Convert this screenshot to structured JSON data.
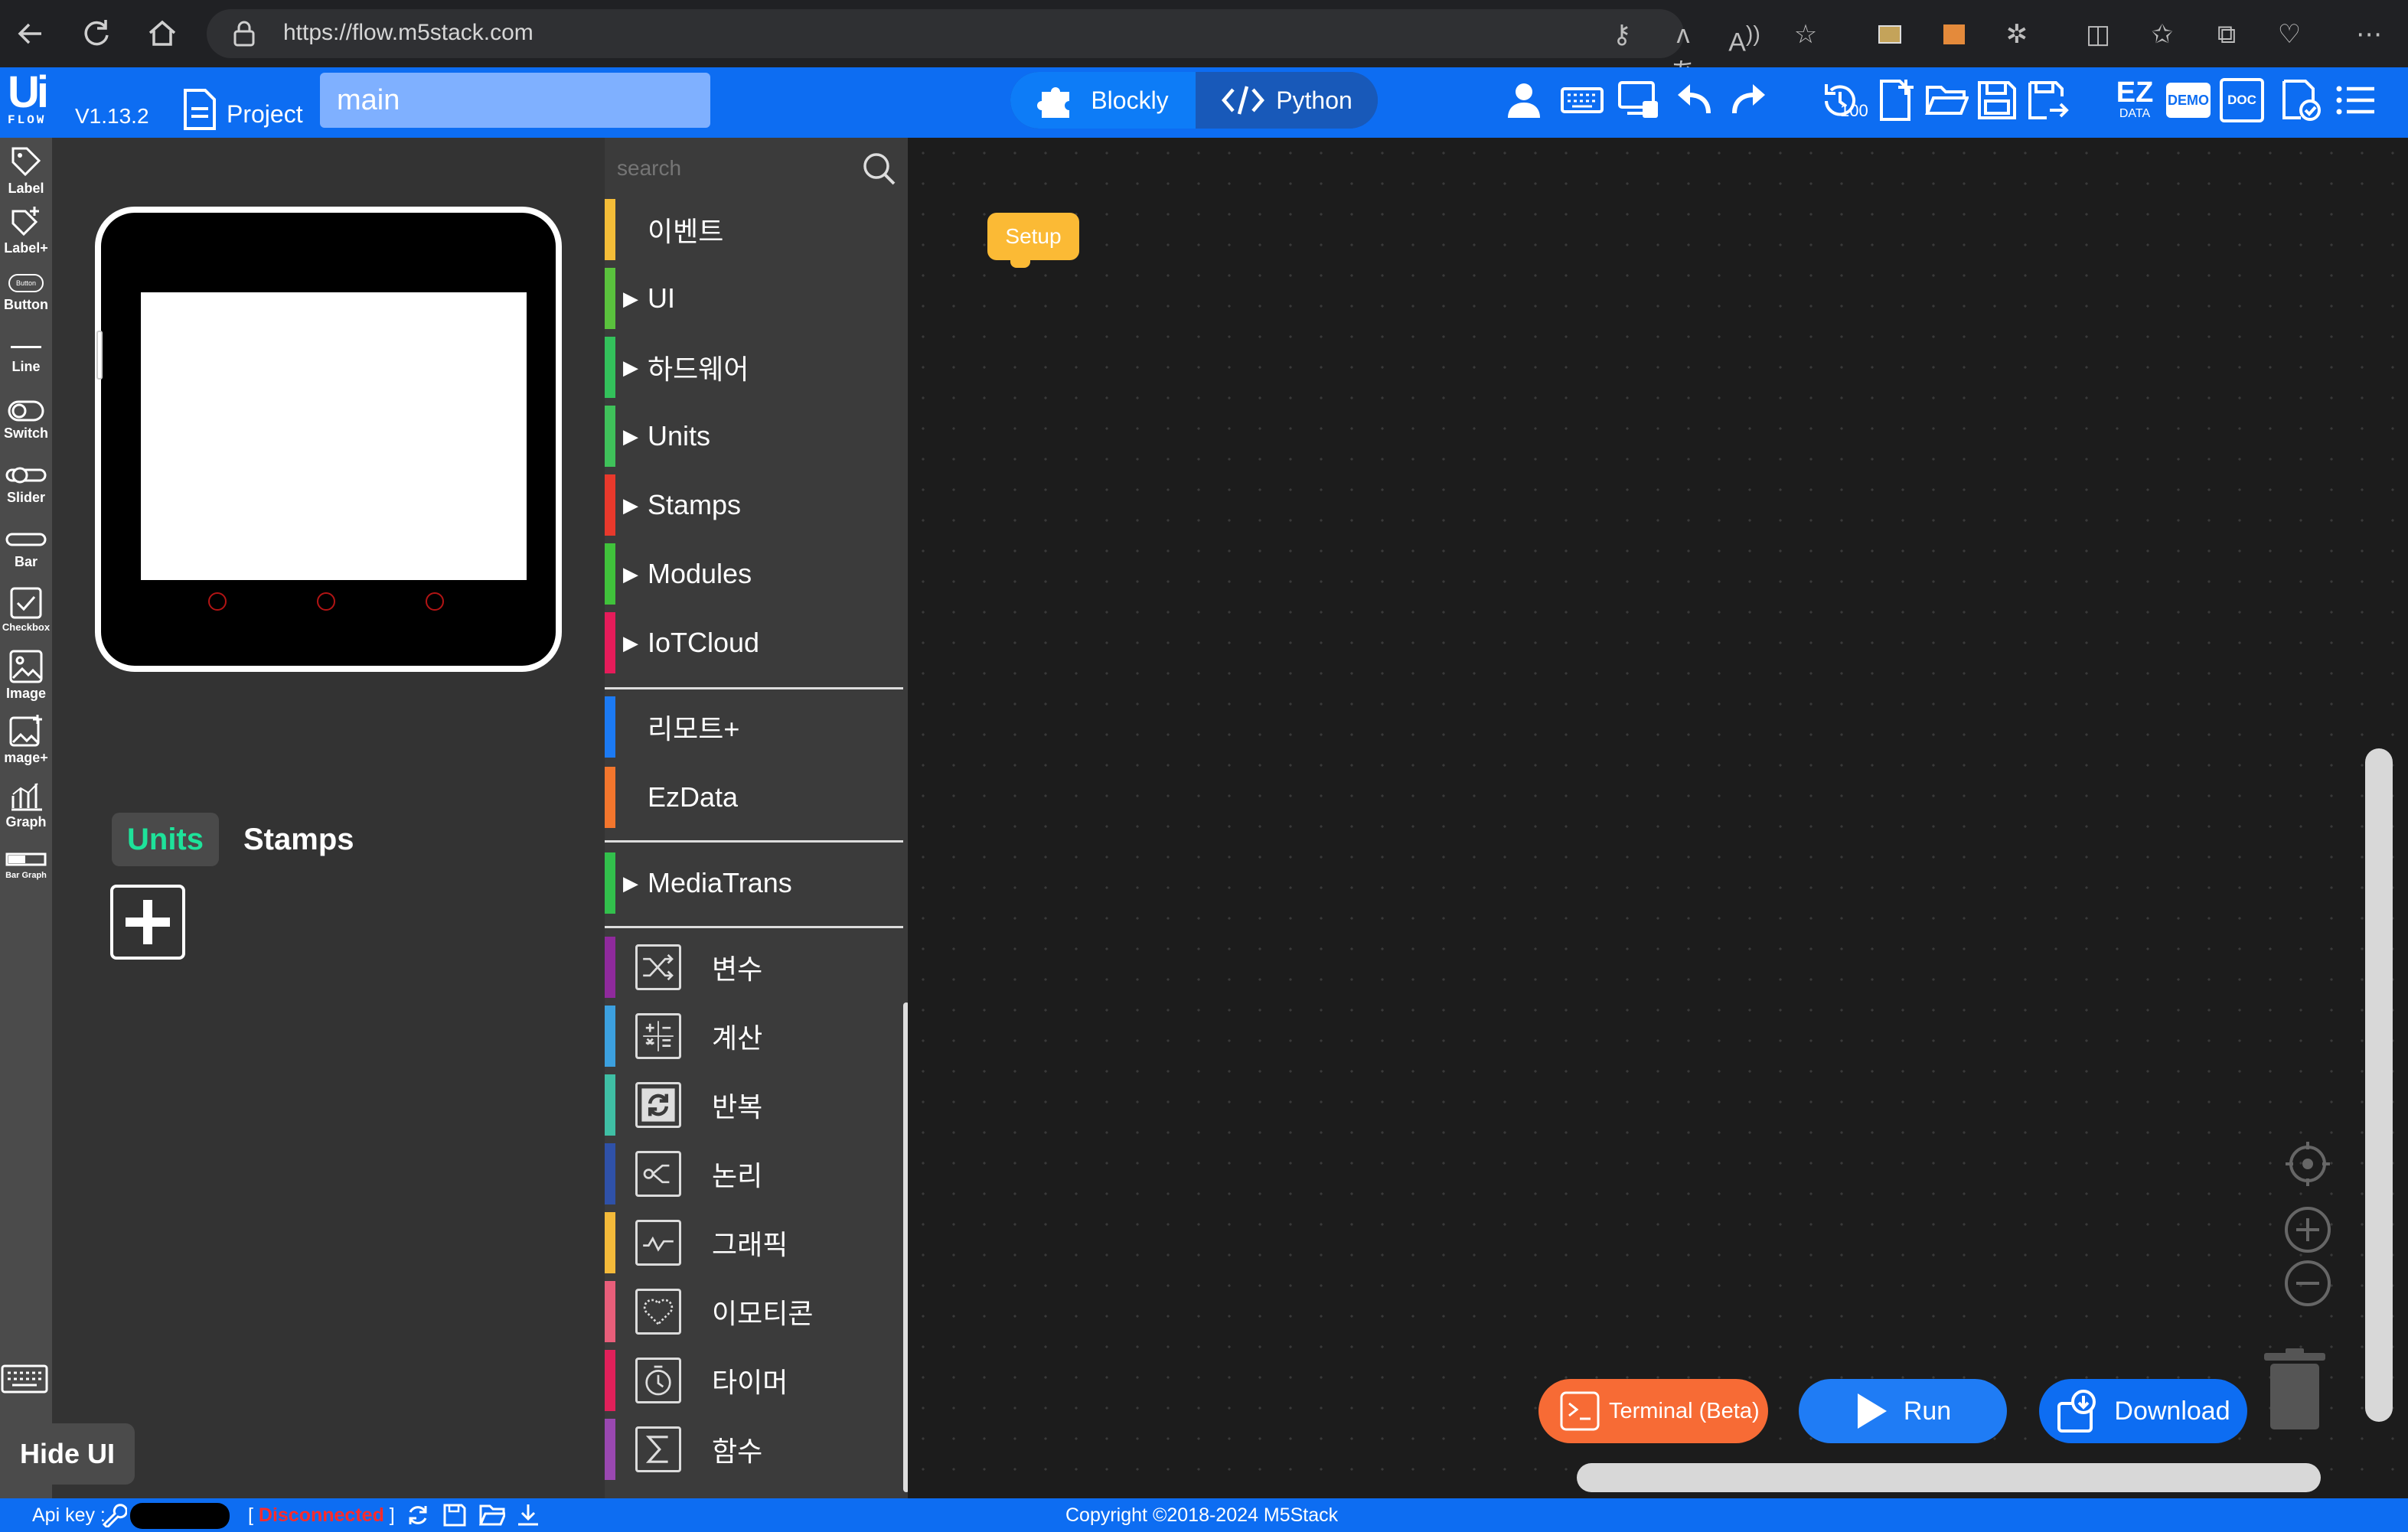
{
  "browser": {
    "url": "https://flow.m5stack.com"
  },
  "header": {
    "logo_main": "Ui",
    "logo_sub": "FLOW",
    "version": "V1.13.2",
    "project_label": "Project",
    "project_name": "main",
    "mode_blockly": "Blockly",
    "mode_python": "Python",
    "history_count": "100",
    "ez_main": "EZ",
    "ez_sub": "DATA",
    "demo": "DEMO",
    "doc": "DOC",
    "accent": "#0d6df2"
  },
  "rail": {
    "items": [
      "Label",
      "Label+",
      "Button",
      "Line",
      "Switch",
      "Slider",
      "Bar",
      "Checkbox",
      "Image",
      "mage+",
      "Graph",
      "Bar Graph"
    ],
    "button_mini": "Button"
  },
  "preview": {
    "tabs": {
      "units": "Units",
      "stamps": "Stamps"
    },
    "hide_ui": "Hide UI"
  },
  "toolbox": {
    "search_placeholder": "search",
    "categories": [
      {
        "name": "이벤트",
        "color": "#f4bd38",
        "arrow": ""
      },
      {
        "name": "UI",
        "color": "#5ac23d",
        "arrow": "▶"
      },
      {
        "name": "하드웨어",
        "color": "#33c15b",
        "arrow": "▶"
      },
      {
        "name": "Units",
        "color": "#3fc15a",
        "arrow": "▶"
      },
      {
        "name": "Stamps",
        "color": "#e8392c",
        "arrow": "▶"
      },
      {
        "name": "Modules",
        "color": "#40c23b",
        "arrow": "▶"
      },
      {
        "name": "IoTCloud",
        "color": "#e51c5a",
        "arrow": "▶"
      },
      {
        "name": "리모트+",
        "color": "#1c7af3",
        "arrow": ""
      },
      {
        "name": "EzData",
        "color": "#f3762d",
        "arrow": ""
      },
      {
        "name": "MediaTrans",
        "color": "#32c04c",
        "arrow": "▶"
      }
    ],
    "builtins": [
      {
        "name": "변수",
        "color": "#8f2a9c",
        "icon": "shuffle-icon"
      },
      {
        "name": "계산",
        "color": "#3ca0df",
        "icon": "calculator-icon"
      },
      {
        "name": "반복",
        "color": "#3fbfa4",
        "icon": "loop-icon"
      },
      {
        "name": "논리",
        "color": "#2f51a8",
        "icon": "logic-branch-icon"
      },
      {
        "name": "그래픽",
        "color": "#f4ba3a",
        "icon": "graph-icon"
      },
      {
        "name": "이모티콘",
        "color": "#e85e7a",
        "icon": "heart-icon"
      },
      {
        "name": "타이머",
        "color": "#e0205a",
        "icon": "timer-icon"
      },
      {
        "name": "함수",
        "color": "#9a48b1",
        "icon": "sigma-icon"
      }
    ]
  },
  "workspace": {
    "setup_block": "Setup",
    "terminal_label": "Terminal (Beta)",
    "run_label": "Run",
    "download_label": "Download"
  },
  "status": {
    "api_key_label": "Api key :",
    "connection": "Disconnected",
    "copyright": "Copyright ©2018-2024 M5Stack"
  }
}
